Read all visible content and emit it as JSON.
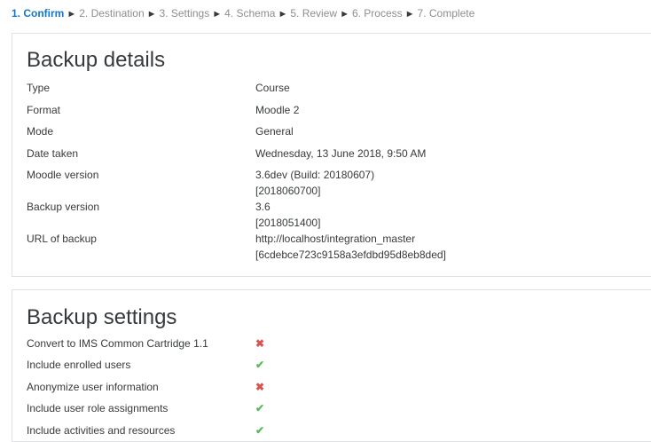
{
  "progress": {
    "steps": [
      {
        "label": "1. Confirm"
      },
      {
        "label": "2. Destination"
      },
      {
        "label": "3. Settings"
      },
      {
        "label": "4. Schema"
      },
      {
        "label": "5. Review"
      },
      {
        "label": "6. Process"
      },
      {
        "label": "7. Complete"
      }
    ],
    "separator": "►"
  },
  "details": {
    "title": "Backup details",
    "rows": [
      {
        "label": "Type",
        "value": "Course",
        "value2": ""
      },
      {
        "label": "Format",
        "value": "Moodle 2",
        "value2": ""
      },
      {
        "label": "Mode",
        "value": "General",
        "value2": ""
      },
      {
        "label": "Date taken",
        "value": "Wednesday, 13 June 2018, 9:50 AM",
        "value2": ""
      },
      {
        "label": "Moodle version",
        "value": "3.6dev (Build: 20180607)",
        "value2": "[2018060700]"
      },
      {
        "label": "Backup version",
        "value": "3.6",
        "value2": "[2018051400]"
      },
      {
        "label": "URL of backup",
        "value": "http://localhost/integration_master",
        "value2": "[6cdebce723c9158a3efdbd95d8eb8ded]"
      }
    ]
  },
  "settings": {
    "title": "Backup settings",
    "rows": [
      {
        "label": "Convert to IMS Common Cartridge 1.1",
        "icon": "cross-icon",
        "glyph": "✖"
      },
      {
        "label": "Include enrolled users",
        "icon": "check-icon",
        "glyph": "✔"
      },
      {
        "label": "Anonymize user information",
        "icon": "cross-icon",
        "glyph": "✖"
      },
      {
        "label": "Include user role assignments",
        "icon": "check-icon",
        "glyph": "✔"
      },
      {
        "label": "Include activities and resources",
        "icon": "check-icon",
        "glyph": "✔"
      }
    ],
    "colors": {
      "cross": "#d9534f",
      "check": "#5cb85c"
    }
  },
  "colors": {
    "active_step": "#1177d1",
    "inactive_step": "#8a8f93",
    "border": "#dee2e6"
  }
}
